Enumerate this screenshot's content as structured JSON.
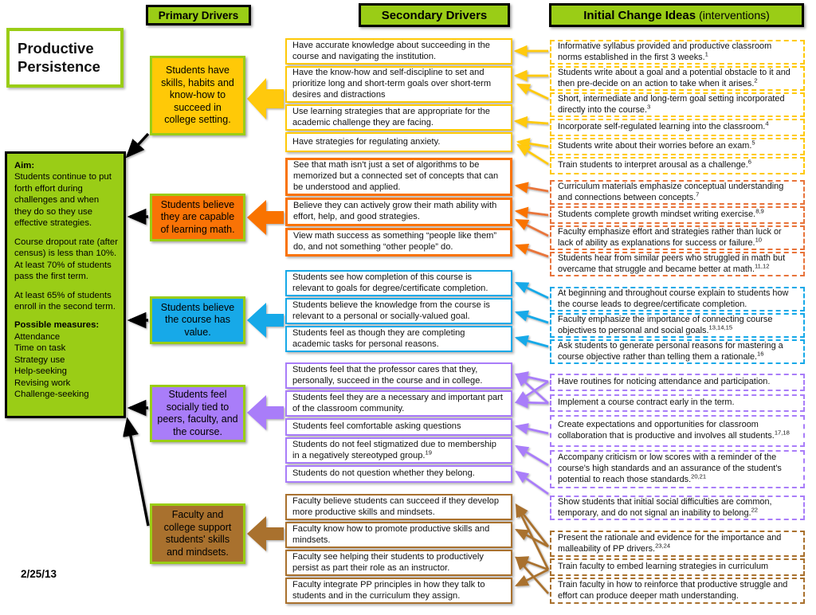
{
  "meta": {
    "date": "2/25/13",
    "title_line1": "Productive",
    "title_line2": "Persistence"
  },
  "headers": {
    "primary": "Primary Drivers",
    "secondary": "Secondary Drivers",
    "ideas_main": "Initial Change Ideas",
    "ideas_sub": "(interventions)"
  },
  "colors": {
    "green": "#9ACD16",
    "yellow": "#FFC907",
    "orange": "#F97306",
    "blue": "#17A9E8",
    "purple": "#A97DF9",
    "brown": "#A9712E",
    "white": "#FFFFFF",
    "black": "#000000"
  },
  "aim": {
    "label": "Aim:",
    "statement": "Students continue to put forth effort during challenges and when they do so they use effective strategies.",
    "metric1": "Course dropout rate (after census) is less than 10%.",
    "metric2": "At least 70% of students pass the first term.",
    "metric3": "At least 65% of students enroll in the second term.",
    "measures_label": "Possible measures:",
    "measures": [
      "Attendance",
      "Time on task",
      "Strategy use",
      "Help-seeking",
      "Revising work",
      "Challenge-seeking"
    ]
  },
  "primary_drivers": [
    {
      "id": "skills",
      "label": "Students have skills, habits and know-how to succeed in college setting.",
      "color": "#FFC907"
    },
    {
      "id": "math",
      "label": "Students believe they are capable of learning math.",
      "color": "#F97306"
    },
    {
      "id": "value",
      "label": "Students believe the course has value.",
      "color": "#17A9E8"
    },
    {
      "id": "social",
      "label": "Students feel socially tied to peers, faculty, and the course.",
      "color": "#A97DF9"
    },
    {
      "id": "faculty",
      "label": "Faculty and college support students' skills and mindsets.",
      "color": "#A9712E"
    }
  ],
  "secondary_drivers": [
    {
      "group": "skills",
      "text": "Have accurate knowledge about succeeding in the course and navigating the institution."
    },
    {
      "group": "skills",
      "text": "Have the know-how and self-discipline to set and prioritize long and short-term goals over short-term desires and distractions"
    },
    {
      "group": "skills",
      "text": "Use learning strategies that are appropriate for the academic challenge they are facing."
    },
    {
      "group": "skills",
      "text": "Have strategies for regulating anxiety."
    },
    {
      "group": "math",
      "text": "See that math isn't just a set of algorithms to be memorized but a connected set of concepts that can be understood and applied."
    },
    {
      "group": "math",
      "text": "Believe they can actively grow their math ability with effort, help, and good strategies."
    },
    {
      "group": "math",
      "text": "View math success as something “people like them” do, and not something “other people” do."
    },
    {
      "group": "value",
      "text": "Students see how completion of this course is relevant to goals for degree/certificate completion."
    },
    {
      "group": "value",
      "text": "Students believe the knowledge from the course is relevant to a personal or socially-valued goal."
    },
    {
      "group": "value",
      "text": "Students feel as though they are completing academic tasks for personal reasons."
    },
    {
      "group": "social",
      "text": "Students feel that the professor cares that they, personally, succeed in the course and in college."
    },
    {
      "group": "social",
      "text": "Students feel they are a necessary and important part of the classroom community."
    },
    {
      "group": "social",
      "text": "Students feel comfortable asking questions"
    },
    {
      "group": "social",
      "text": "Students do not feel stigmatized due to membership in a negatively stereotyped group.",
      "sup": "19"
    },
    {
      "group": "social",
      "text": "Students do not question whether they belong."
    },
    {
      "group": "faculty",
      "text": "Faculty believe students can succeed if they develop more productive skills and mindsets."
    },
    {
      "group": "faculty",
      "text": "Faculty know how to promote productive skills and mindsets."
    },
    {
      "group": "faculty",
      "text": "Faculty see helping their students to productively persist as part their role as an instructor."
    },
    {
      "group": "faculty",
      "text": "Faculty integrate PP principles in how they talk to students and in the curriculum they assign."
    }
  ],
  "change_ideas": [
    {
      "group": "skills",
      "text": "Informative syllabus provided and productive classroom norms established in the first 3 weeks.",
      "sup": "1"
    },
    {
      "group": "skills",
      "text": "Students write about a goal and a potential obstacle to it and then pre-decide on an action to take when it arises.",
      "sup": "2"
    },
    {
      "group": "skills",
      "text": "Short, intermediate and long-term goal setting incorporated directly into the course.",
      "sup": "3"
    },
    {
      "group": "skills",
      "text": "Incorporate self-regulated learning into the classroom.",
      "sup": "4"
    },
    {
      "group": "skills",
      "text": "Students write about their worries before an exam.",
      "sup": "5"
    },
    {
      "group": "skills",
      "text": "Train students to interpret arousal as a challenge.",
      "sup": "6"
    },
    {
      "group": "math",
      "text": "Curriculum materials emphasize conceptual understanding and connections between concepts.",
      "sup": "7"
    },
    {
      "group": "math",
      "text": "Students complete growth mindset writing exercise.",
      "sup": "8,9"
    },
    {
      "group": "math",
      "text": "Faculty emphasize effort and strategies rather than luck or lack of ability as explanations for success or failure.",
      "sup": "10"
    },
    {
      "group": "math",
      "text": "Students hear from similar peers who struggled in math but overcame that struggle and became better at math.",
      "sup": "11,12"
    },
    {
      "group": "value",
      "text": "At beginning and throughout course explain to students how the course leads to degree/certificate completion.",
      "sup": ""
    },
    {
      "group": "value",
      "text": "Faculty emphasize the importance of connecting course objectives to personal and social goals.",
      "sup": "13,14,15"
    },
    {
      "group": "value",
      "text": "Ask students to generate personal reasons for mastering a course objective rather than telling them a rationale.",
      "sup": "16"
    },
    {
      "group": "social",
      "text": "Have routines for noticing attendance and participation.",
      "sup": ""
    },
    {
      "group": "social",
      "text": "Implement a course contract early in the term.",
      "sup": ""
    },
    {
      "group": "social",
      "text": "Create expectations and opportunities for classroom collaboration that is productive and involves all students.",
      "sup": "17,18"
    },
    {
      "group": "social",
      "text": "Accompany criticism or low scores with a reminder of the course's high standards and an assurance of the student's potential to reach those standards.",
      "sup": "20,21"
    },
    {
      "group": "social",
      "text": "Show students that initial social difficulties are common, temporary, and do not signal an inability to belong.",
      "sup": "22"
    },
    {
      "group": "faculty",
      "text": "Present the rationale and evidence for the importance and malleability of PP drivers.",
      "sup": "23,24"
    },
    {
      "group": "faculty",
      "text": "Train faculty to embed learning strategies in curriculum",
      "sup": ""
    },
    {
      "group": "faculty",
      "text": "Train faculty in how to reinforce that productive struggle and effort can produce deeper math understanding.",
      "sup": ""
    }
  ]
}
